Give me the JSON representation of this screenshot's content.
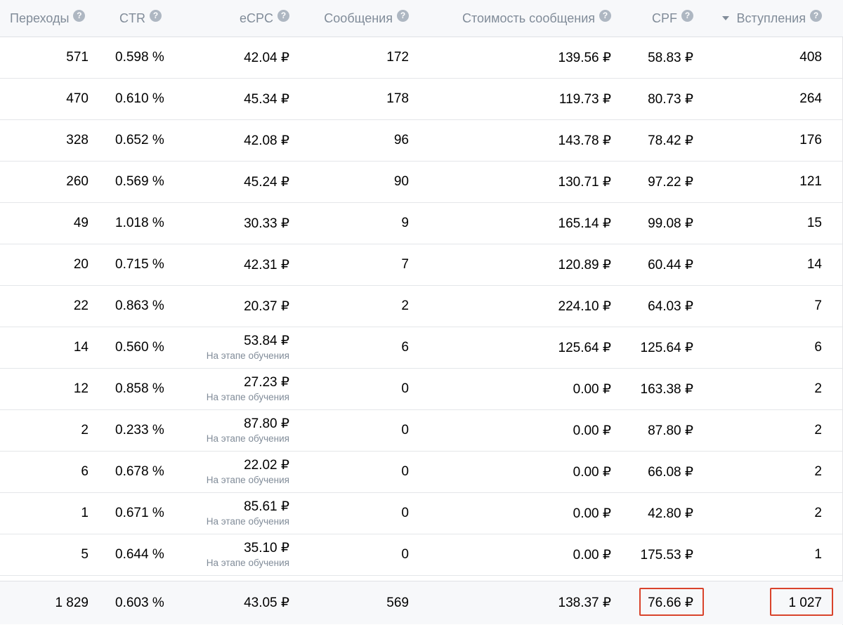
{
  "currency": "₽",
  "colors": {
    "accent_highlight": "#d9432b",
    "muted_text": "#818c99",
    "header_bg": "#f7f8fa"
  },
  "headers": [
    "Переходы",
    "CTR",
    "eCPC",
    "Сообщения",
    "Стоимость сообщения",
    "CPF",
    "Вступления"
  ],
  "sorted_column": "Вступления",
  "help_icon": "question-circle-icon",
  "sort_icon": "caret-down-icon",
  "rows": [
    {
      "clicks": "571",
      "ctr": "0.598 %",
      "ecpc": "42.04",
      "ecpc_note": "",
      "messages": "172",
      "msg_cost": "139.56",
      "cpf": "58.83",
      "joins": "408"
    },
    {
      "clicks": "470",
      "ctr": "0.610 %",
      "ecpc": "45.34",
      "ecpc_note": "",
      "messages": "178",
      "msg_cost": "119.73",
      "cpf": "80.73",
      "joins": "264"
    },
    {
      "clicks": "328",
      "ctr": "0.652 %",
      "ecpc": "42.08",
      "ecpc_note": "",
      "messages": "96",
      "msg_cost": "143.78",
      "cpf": "78.42",
      "joins": "176"
    },
    {
      "clicks": "260",
      "ctr": "0.569 %",
      "ecpc": "45.24",
      "ecpc_note": "",
      "messages": "90",
      "msg_cost": "130.71",
      "cpf": "97.22",
      "joins": "121"
    },
    {
      "clicks": "49",
      "ctr": "1.018 %",
      "ecpc": "30.33",
      "ecpc_note": "",
      "messages": "9",
      "msg_cost": "165.14",
      "cpf": "99.08",
      "joins": "15"
    },
    {
      "clicks": "20",
      "ctr": "0.715 %",
      "ecpc": "42.31",
      "ecpc_note": "",
      "messages": "7",
      "msg_cost": "120.89",
      "cpf": "60.44",
      "joins": "14"
    },
    {
      "clicks": "22",
      "ctr": "0.863 %",
      "ecpc": "20.37",
      "ecpc_note": "",
      "messages": "2",
      "msg_cost": "224.10",
      "cpf": "64.03",
      "joins": "7"
    },
    {
      "clicks": "14",
      "ctr": "0.560 %",
      "ecpc": "53.84",
      "ecpc_note": "На этапе обучения",
      "messages": "6",
      "msg_cost": "125.64",
      "cpf": "125.64",
      "joins": "6"
    },
    {
      "clicks": "12",
      "ctr": "0.858 %",
      "ecpc": "27.23",
      "ecpc_note": "На этапе обучения",
      "messages": "0",
      "msg_cost": "0.00",
      "cpf": "163.38",
      "joins": "2"
    },
    {
      "clicks": "2",
      "ctr": "0.233 %",
      "ecpc": "87.80",
      "ecpc_note": "На этапе обучения",
      "messages": "0",
      "msg_cost": "0.00",
      "cpf": "87.80",
      "joins": "2"
    },
    {
      "clicks": "6",
      "ctr": "0.678 %",
      "ecpc": "22.02",
      "ecpc_note": "На этапе обучения",
      "messages": "0",
      "msg_cost": "0.00",
      "cpf": "66.08",
      "joins": "2"
    },
    {
      "clicks": "1",
      "ctr": "0.671 %",
      "ecpc": "85.61",
      "ecpc_note": "На этапе обучения",
      "messages": "0",
      "msg_cost": "0.00",
      "cpf": "42.80",
      "joins": "2"
    },
    {
      "clicks": "5",
      "ctr": "0.644 %",
      "ecpc": "35.10",
      "ecpc_note": "На этапе обучения",
      "messages": "0",
      "msg_cost": "0.00",
      "cpf": "175.53",
      "joins": "1"
    }
  ],
  "total": {
    "clicks": "1 829",
    "ctr": "0.603 %",
    "ecpc": "43.05",
    "ecpc_note": "",
    "messages": "569",
    "msg_cost": "138.37",
    "cpf": "76.66",
    "joins": "1 027"
  },
  "highlighted_total_fields": [
    "cpf",
    "joins"
  ]
}
